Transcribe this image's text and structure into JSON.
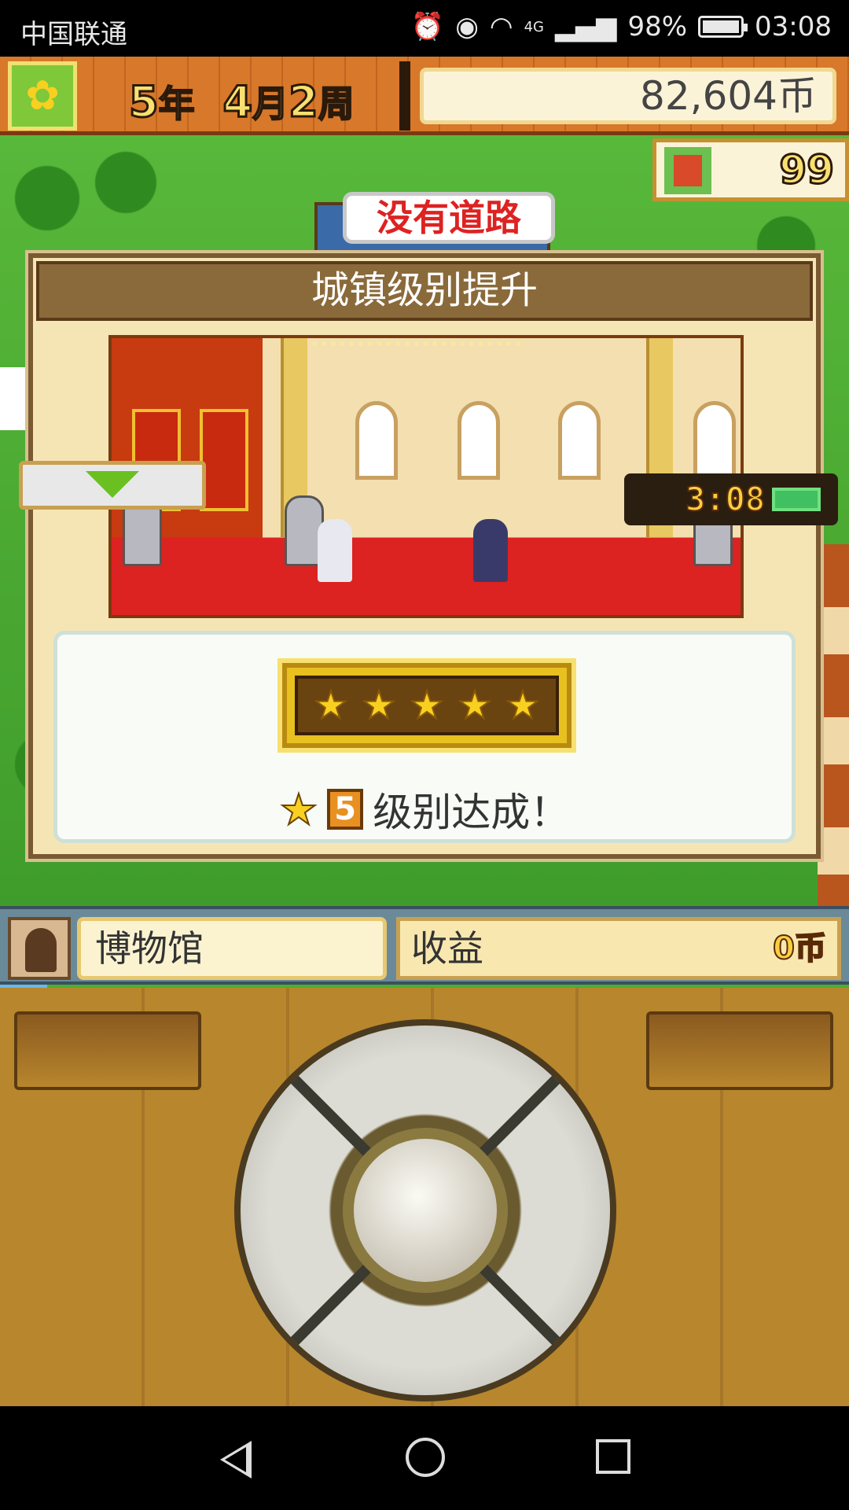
{
  "status_bar": {
    "carrier": "中国联通",
    "network": "4G",
    "battery": "98%",
    "time": "03:08",
    "icons": [
      "alarm-icon",
      "eye-icon",
      "wifi-icon",
      "signal-icon",
      "battery-icon"
    ]
  },
  "hud": {
    "year_num": "5",
    "year_unit": "年",
    "month_num": "4",
    "month_unit": "月",
    "week_num": "2",
    "week_unit": "周",
    "money": "82,604币",
    "population": "99"
  },
  "map_labels": {
    "no_road": "没有道路"
  },
  "dialog": {
    "title": "城镇级别提升",
    "stars": [
      "★",
      "★",
      "★",
      "★",
      "★"
    ],
    "level": "5",
    "achieve_text": "级别达成！"
  },
  "info_bar": {
    "building_name": "博物馆",
    "income_label": "收益",
    "income_value": "0币"
  },
  "controller": {
    "clock": "3:08"
  },
  "colors": {
    "accent_gold": "#f8d020",
    "title_brown": "#8a6a3a",
    "carpet_red": "#dd2222"
  }
}
